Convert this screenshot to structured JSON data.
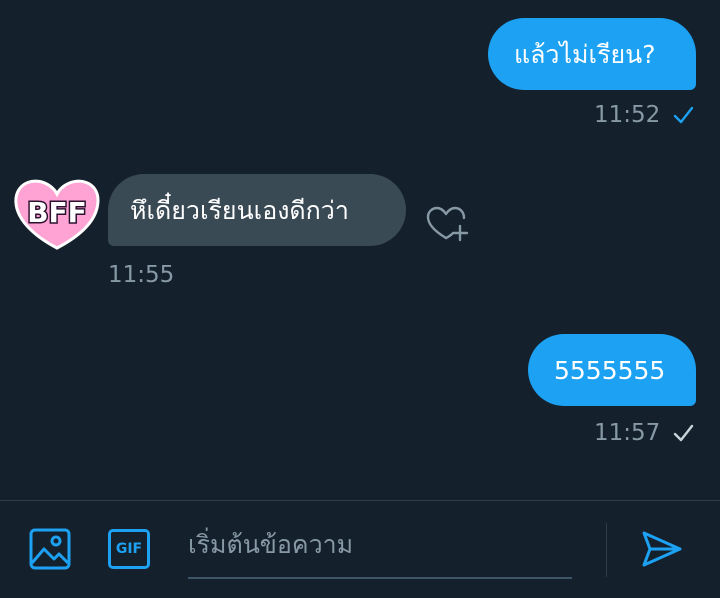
{
  "messages": [
    {
      "direction": "outgoing",
      "text": "แล้วไม่เรียน?",
      "time": "11:52",
      "status": "read"
    },
    {
      "direction": "incoming",
      "text": "หึเดี๋ยวเรียนเองดีกว่า",
      "time": "11:55",
      "avatar_label": "BFF"
    },
    {
      "direction": "outgoing",
      "text": "5555555",
      "time": "11:57",
      "status": "sent"
    }
  ],
  "composer": {
    "placeholder": "เริ่มต้นข้อความ",
    "gif_label": "GIF"
  },
  "colors": {
    "background": "#14202b",
    "outgoing_bubble": "#1da1f2",
    "incoming_bubble": "#3a4a55",
    "accent": "#1da1f2",
    "muted_text": "#8899a6",
    "avatar_heart": "#ff8fc8"
  },
  "icons": [
    "checkmark-icon",
    "heart-plus-icon",
    "image-icon",
    "gif-icon",
    "send-icon"
  ]
}
